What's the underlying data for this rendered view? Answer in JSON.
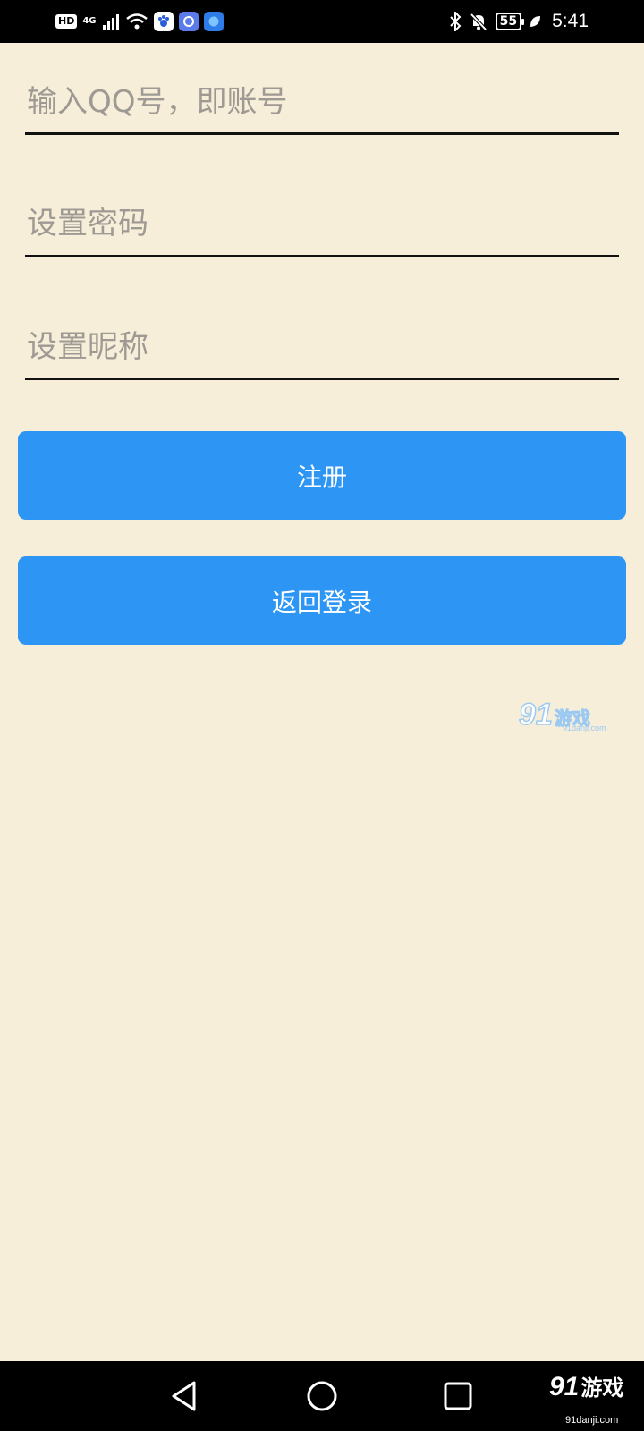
{
  "status_bar": {
    "hd_label": "HD",
    "network_label": "4G",
    "battery_level": "55",
    "time": "5:41",
    "left_icons": [
      "hd-icon",
      "signal-icon",
      "wifi-icon",
      "baidu-app-icon",
      "music-app-icon",
      "browser-app-icon"
    ],
    "right_icons": [
      "bluetooth-icon",
      "mute-icon",
      "battery-icon",
      "leaf-icon"
    ]
  },
  "form": {
    "qq_placeholder": "输入QQ号，即账号",
    "password_placeholder": "设置密码",
    "nickname_placeholder": "设置昵称",
    "qq_value": "",
    "password_value": "",
    "nickname_value": ""
  },
  "buttons": {
    "register_label": "注册",
    "back_login_label": "返回登录"
  },
  "watermark": {
    "brand_number": "91",
    "brand_text": "游戏",
    "url": "91danji.com"
  },
  "nav_bar": {
    "icons": [
      "back-triangle-icon",
      "home-circle-icon",
      "recents-square-icon"
    ]
  },
  "colors": {
    "background": "#F7EEDA",
    "button": "#2D96F5",
    "button_text": "#FFFFFF",
    "placeholder": "#9E9A93"
  }
}
